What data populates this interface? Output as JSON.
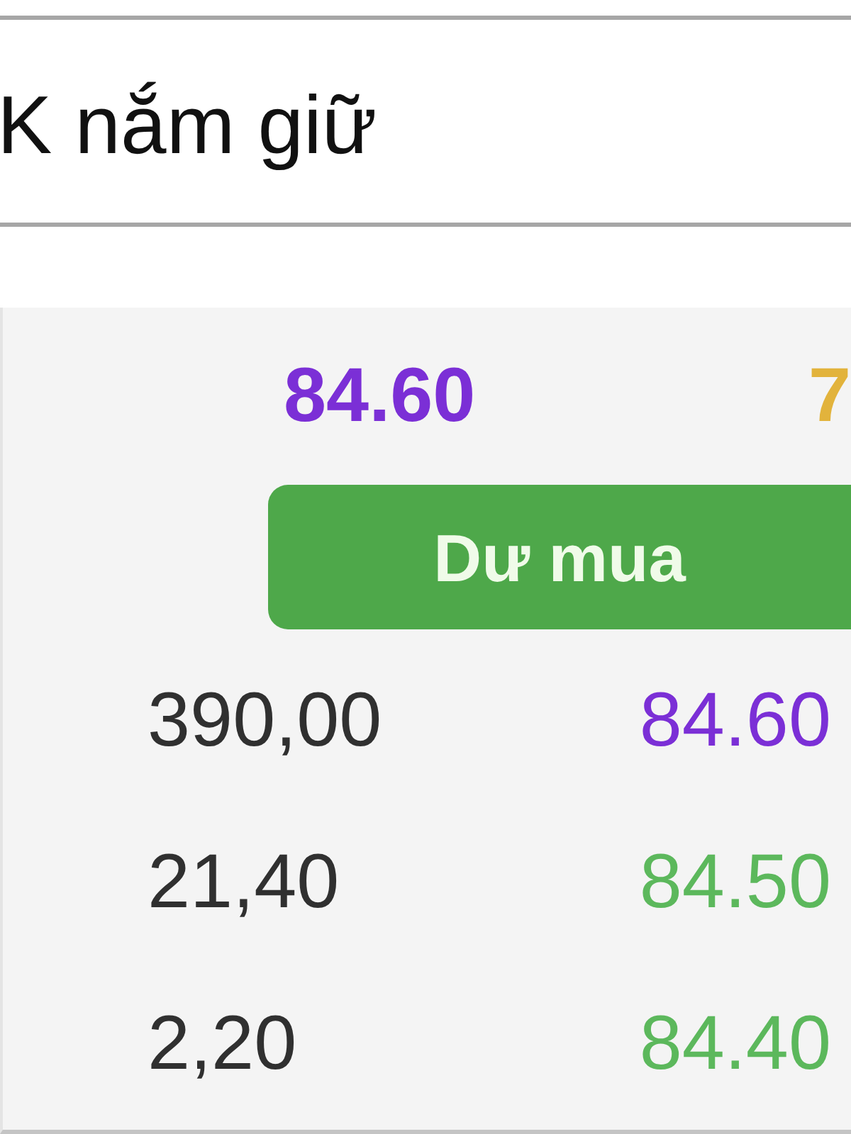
{
  "section": {
    "title": "K nắm giữ"
  },
  "quote": {
    "prices": [
      {
        "text": "84.60",
        "color": "#7b2fd6"
      },
      {
        "text": "7",
        "color": "#e2b33c"
      }
    ]
  },
  "order_book": {
    "header_button": {
      "label": "Dư mua"
    },
    "rows": [
      {
        "volume": "390,00",
        "price": "84.60",
        "color": "#7b2fd6"
      },
      {
        "volume": "21,40",
        "price": "84.50",
        "color": "#5cb85c"
      },
      {
        "volume": "2,20",
        "price": "84.40",
        "color": "#5cb85c"
      }
    ]
  }
}
